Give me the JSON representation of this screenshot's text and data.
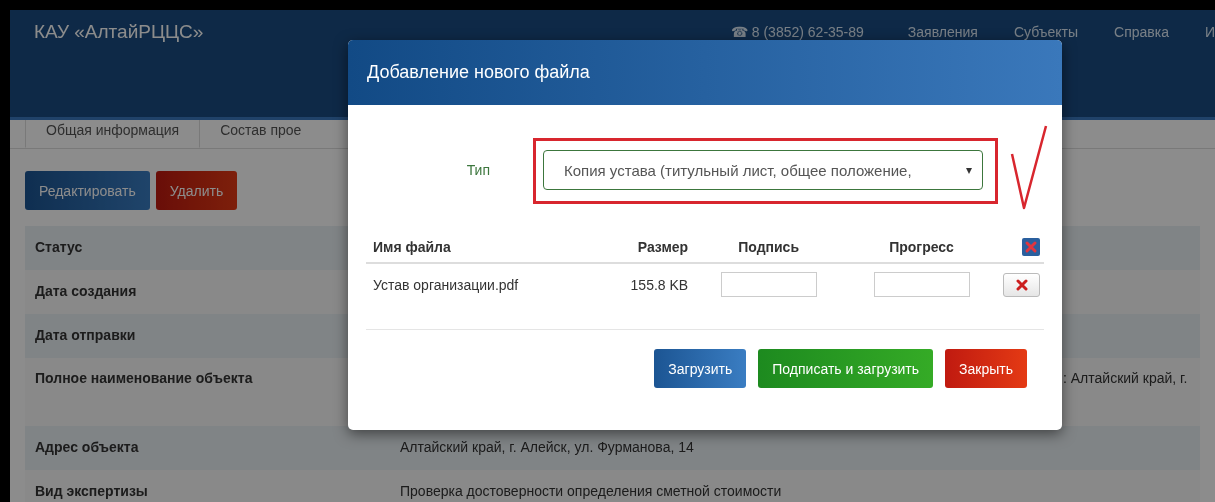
{
  "header": {
    "brand": "КАУ «АлтайРЦЦС»",
    "phone_icon": "☎",
    "phone": "8 (3852) 62-35-89",
    "nav": [
      "Заявления",
      "Субъекты",
      "Справка",
      "И"
    ]
  },
  "tabs": [
    {
      "label": "Общая информация",
      "selected": true
    },
    {
      "label": "Состав прое",
      "selected": false
    }
  ],
  "actions": [
    {
      "label": "Редактировать",
      "kind": "primary"
    },
    {
      "label": "Удалить",
      "kind": "danger"
    }
  ],
  "details": [
    {
      "label": "Статус"
    },
    {
      "label": "Дата создания"
    },
    {
      "label": "Дата отправки"
    },
    {
      "label": "Полное наименование объекта",
      "value": ": Алтайский край, г.",
      "kind": "tall"
    },
    {
      "label": "Адрес объекта",
      "value": "Алтайский край, г. Алейск, ул. Фурманова, 14"
    },
    {
      "label": "Вид экспертизы",
      "value": "Проверка достоверности определения сметной стоимости"
    }
  ],
  "modal": {
    "title": "Добавление нового файла",
    "type_label": "Тип",
    "type_value": "Копия устава (титульный лист, общее положение,",
    "type_caret": "▾",
    "columns": [
      "Имя файла",
      "Размер",
      "Подпись",
      "Прогресс"
    ],
    "files": [
      {
        "name": "Устав организации.pdf",
        "size": "155.8 KB"
      }
    ],
    "buttons": [
      {
        "label": "Загрузить",
        "kind": "primary"
      },
      {
        "label": "Подписать и загрузить",
        "kind": "success"
      },
      {
        "label": "Закрыть",
        "kind": "danger"
      }
    ]
  }
}
